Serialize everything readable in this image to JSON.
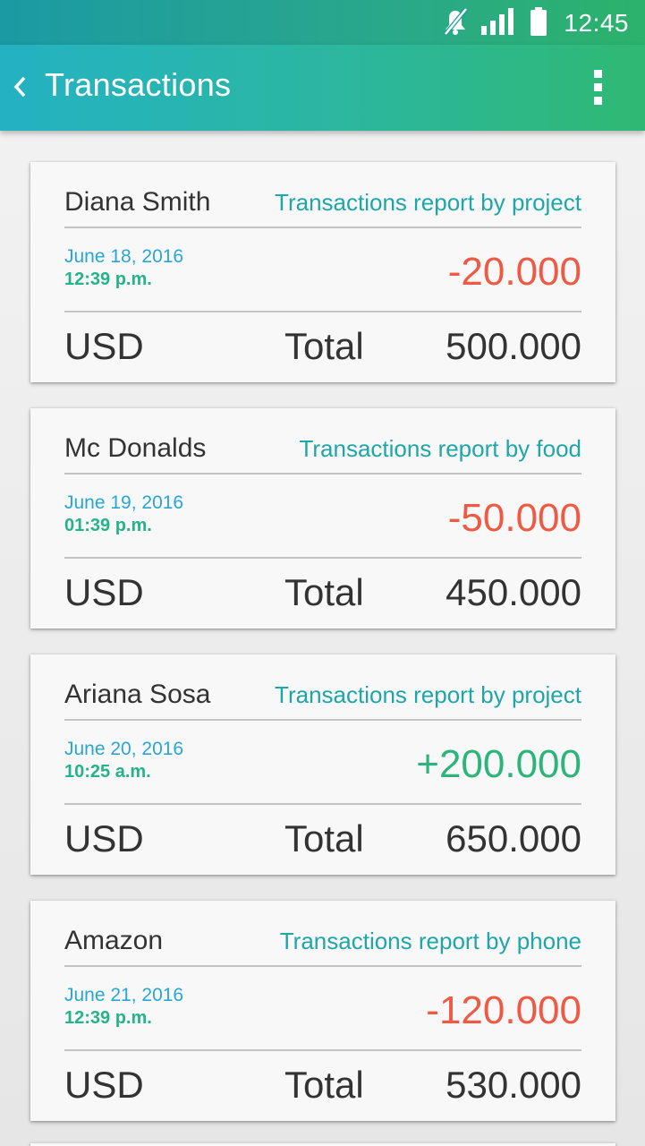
{
  "status_bar": {
    "time": "12:45",
    "icons": [
      "mute-icon",
      "signal-icon",
      "battery-icon"
    ]
  },
  "app_bar": {
    "title": "Transactions",
    "back_icon": "chevron-left-icon",
    "menu_icon": "more-vert-icon"
  },
  "colors": {
    "accent_teal": "#1fa6a8",
    "negative": "#ee5a44",
    "positive": "#2db47c",
    "date_blue": "#2aa6d6",
    "time_green": "#25b38a"
  },
  "transactions": [
    {
      "name": "Diana Smith",
      "report": "Transactions report by project",
      "date": "June 18, 2016",
      "time": "12:39 p.m.",
      "amount": "-20.000",
      "sign": "negative",
      "currency": "USD",
      "total_label": "Total",
      "total": "500.000"
    },
    {
      "name": "Mc Donalds",
      "report": "Transactions report by food",
      "date": "June 19, 2016",
      "time": "01:39 p.m.",
      "amount": "-50.000",
      "sign": "negative",
      "currency": "USD",
      "total_label": "Total",
      "total": "450.000"
    },
    {
      "name": "Ariana Sosa",
      "report": "Transactions report by project",
      "date": "June 20, 2016",
      "time": "10:25 a.m.",
      "amount": "+200.000",
      "sign": "positive",
      "currency": "USD",
      "total_label": "Total",
      "total": "650.000"
    },
    {
      "name": "Amazon",
      "report": "Transactions report by phone",
      "date": "June 21, 2016",
      "time": "12:39 p.m.",
      "amount": "-120.000",
      "sign": "negative",
      "currency": "USD",
      "total_label": "Total",
      "total": "530.000"
    }
  ]
}
